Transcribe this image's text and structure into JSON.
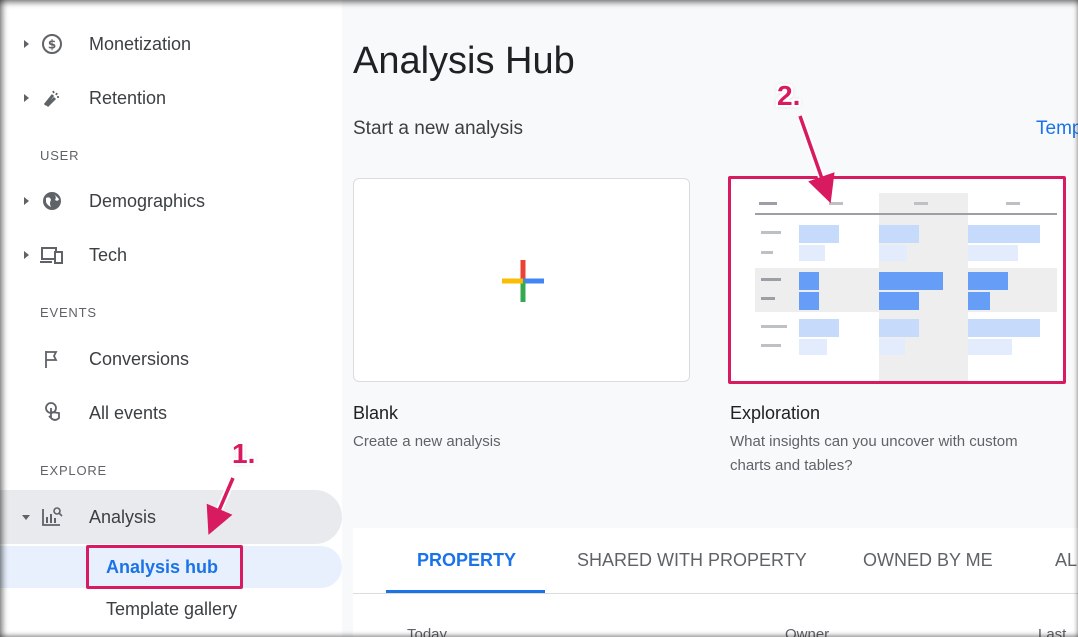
{
  "sidebar": {
    "monetization": "Monetization",
    "retention": "Retention",
    "section_user": "USER",
    "demographics": "Demographics",
    "tech": "Tech",
    "section_events": "EVENTS",
    "conversions": "Conversions",
    "all_events": "All events",
    "section_explore": "EXPLORE",
    "analysis": "Analysis",
    "analysis_hub": "Analysis hub",
    "template_gallery": "Template gallery"
  },
  "main": {
    "title": "Analysis Hub",
    "subtitle": "Start a new analysis",
    "templates_link": "Temp",
    "cards": [
      {
        "title": "Blank",
        "description": "Create a new analysis"
      },
      {
        "title": "Exploration",
        "description_line1": "What insights can you uncover with custom",
        "description_line2": "charts and tables?"
      }
    ],
    "tabs": [
      "PROPERTY",
      "SHARED WITH PROPERTY",
      "OWNED BY ME",
      "AL"
    ],
    "columns": [
      "Today",
      "Owner",
      "Last"
    ]
  },
  "annotations": {
    "step1": "1.",
    "step2": "2."
  },
  "colors": {
    "accent": "#1a73e8",
    "highlight": "#d81b60",
    "plus_blue": "#4285f4",
    "plus_red": "#ea4335",
    "plus_yellow": "#fbbc04",
    "plus_green": "#34a853"
  }
}
